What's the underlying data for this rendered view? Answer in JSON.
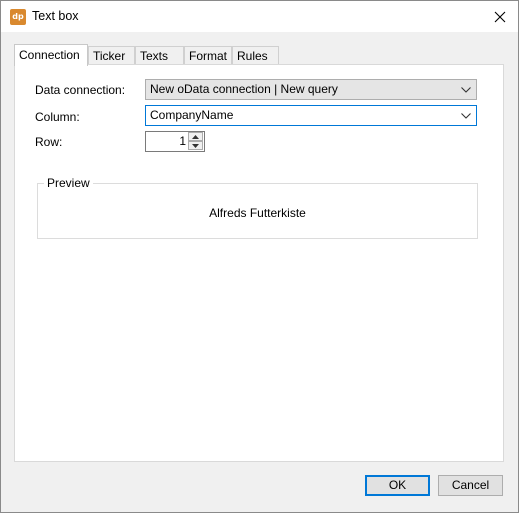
{
  "window": {
    "title": "Text box",
    "icon_text": "dp",
    "icon_color": "#d9892f",
    "close_icon": "close-icon"
  },
  "tabs": [
    {
      "label": "Connection",
      "active": true
    },
    {
      "label": "Ticker",
      "active": false
    },
    {
      "label": "Texts",
      "active": false
    },
    {
      "label": "Format",
      "active": false
    },
    {
      "label": "Rules",
      "active": false
    }
  ],
  "form": {
    "data_connection_label": "Data connection:",
    "data_connection_value": "New oData connection | New query",
    "column_label": "Column:",
    "column_value": "CompanyName",
    "row_label": "Row:",
    "row_value": "1"
  },
  "preview": {
    "legend": "Preview",
    "text": "Alfreds Futterkiste"
  },
  "buttons": {
    "ok": "OK",
    "cancel": "Cancel"
  },
  "colors": {
    "focus_accent": "#0078d7"
  }
}
